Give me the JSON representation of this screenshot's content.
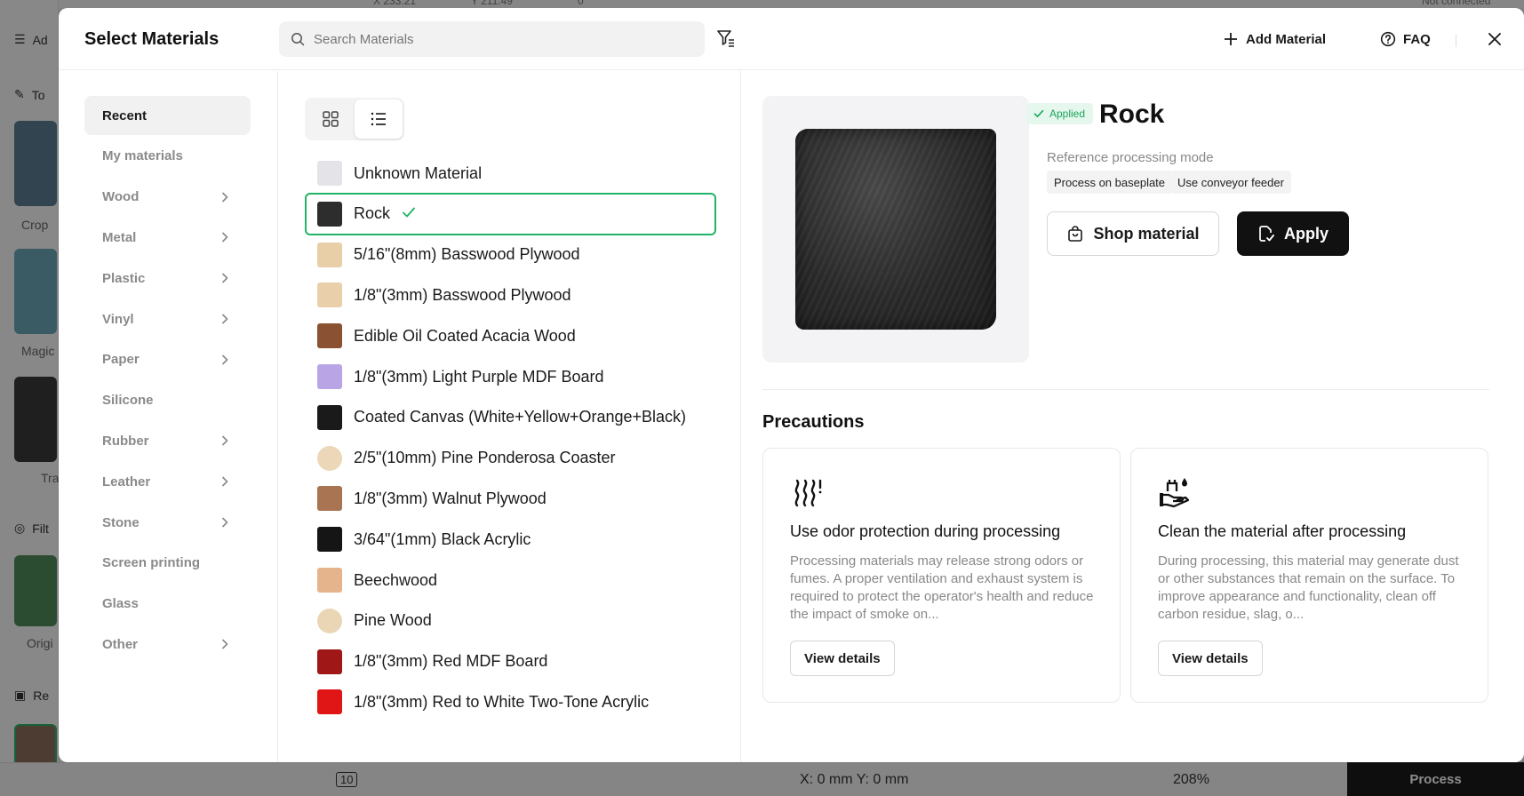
{
  "background": {
    "top": [
      "X 233.21",
      "Y 211.49",
      "0°",
      "Not connected"
    ],
    "left": [
      "Ad",
      "To",
      "Crop",
      "Magic",
      "Tra",
      "Filt",
      "Origi",
      "Re"
    ],
    "bottom": {
      "layer": "10",
      "coords": "X: 0 mm  Y: 0 mm",
      "zoom": "208%",
      "process": "Process"
    }
  },
  "modal": {
    "title": "Select Materials",
    "search_placeholder": "Search Materials",
    "add_material": "Add Material",
    "faq": "FAQ"
  },
  "categories": [
    {
      "label": "Recent",
      "has_children": false,
      "active": true
    },
    {
      "label": "My materials",
      "has_children": false
    },
    {
      "label": "Wood",
      "has_children": true
    },
    {
      "label": "Metal",
      "has_children": true
    },
    {
      "label": "Plastic",
      "has_children": true
    },
    {
      "label": "Vinyl",
      "has_children": true
    },
    {
      "label": "Paper",
      "has_children": true
    },
    {
      "label": "Silicone",
      "has_children": false
    },
    {
      "label": "Rubber",
      "has_children": true
    },
    {
      "label": "Leather",
      "has_children": true
    },
    {
      "label": "Stone",
      "has_children": true
    },
    {
      "label": "Screen printing",
      "has_children": false
    },
    {
      "label": "Glass",
      "has_children": false
    },
    {
      "label": "Other",
      "has_children": true
    }
  ],
  "materials": [
    {
      "label": "Unknown Material",
      "color": "#e4e4e8"
    },
    {
      "label": "Rock",
      "color": "#2d2d2d",
      "selected": true
    },
    {
      "label": "5/16\"(8mm) Basswood Plywood",
      "color": "#e8cfa8"
    },
    {
      "label": "1/8\"(3mm) Basswood Plywood",
      "color": "#e9d0aa"
    },
    {
      "label": "Edible Oil Coated Acacia Wood",
      "color": "#8a5232"
    },
    {
      "label": "1/8\"(3mm) Light Purple MDF Board",
      "color": "#b9a5e6"
    },
    {
      "label": "Coated Canvas (White+Yellow+Orange+Black)",
      "color": "#1a1a1a"
    },
    {
      "label": "2/5\"(10mm) Pine Ponderosa Coaster",
      "color": "#ecd7b8",
      "round": true
    },
    {
      "label": "1/8\"(3mm) Walnut Plywood",
      "color": "#a87452"
    },
    {
      "label": "3/64\"(1mm) Black Acrylic",
      "color": "#151515"
    },
    {
      "label": "Beechwood",
      "color": "#e6b48c"
    },
    {
      "label": "Pine Wood",
      "color": "#ead6b4",
      "round": true
    },
    {
      "label": "1/8\"(3mm) Red MDF Board",
      "color": "#a01717"
    },
    {
      "label": "1/8\"(3mm) Red to White Two-Tone Acrylic",
      "color": "#e01515"
    }
  ],
  "detail": {
    "status": "Applied",
    "name": "Rock",
    "ref_mode": "Reference processing mode",
    "tags": [
      "Process on baseplate",
      "Use conveyor feeder"
    ],
    "shop": "Shop material",
    "apply": "Apply",
    "precautions_title": "Precautions",
    "cards": [
      {
        "icon": "odor-heat-icon",
        "title": "Use odor protection during processing",
        "text": "Processing materials may release strong odors or fumes. A proper ventilation and exhaust system is required to protect the operator's health and reduce the impact of smoke on...",
        "button": "View details"
      },
      {
        "icon": "hand-clean-icon",
        "title": "Clean the material after processing",
        "text": "During processing, this material may generate dust or other substances that remain on the surface. To improve appearance and functionality, clean off carbon residue, slag, o...",
        "button": "View details"
      }
    ]
  },
  "colors": {
    "accent_green": "#22b466",
    "applied_bg": "#e6f7ee",
    "primary_dark": "#111111"
  }
}
